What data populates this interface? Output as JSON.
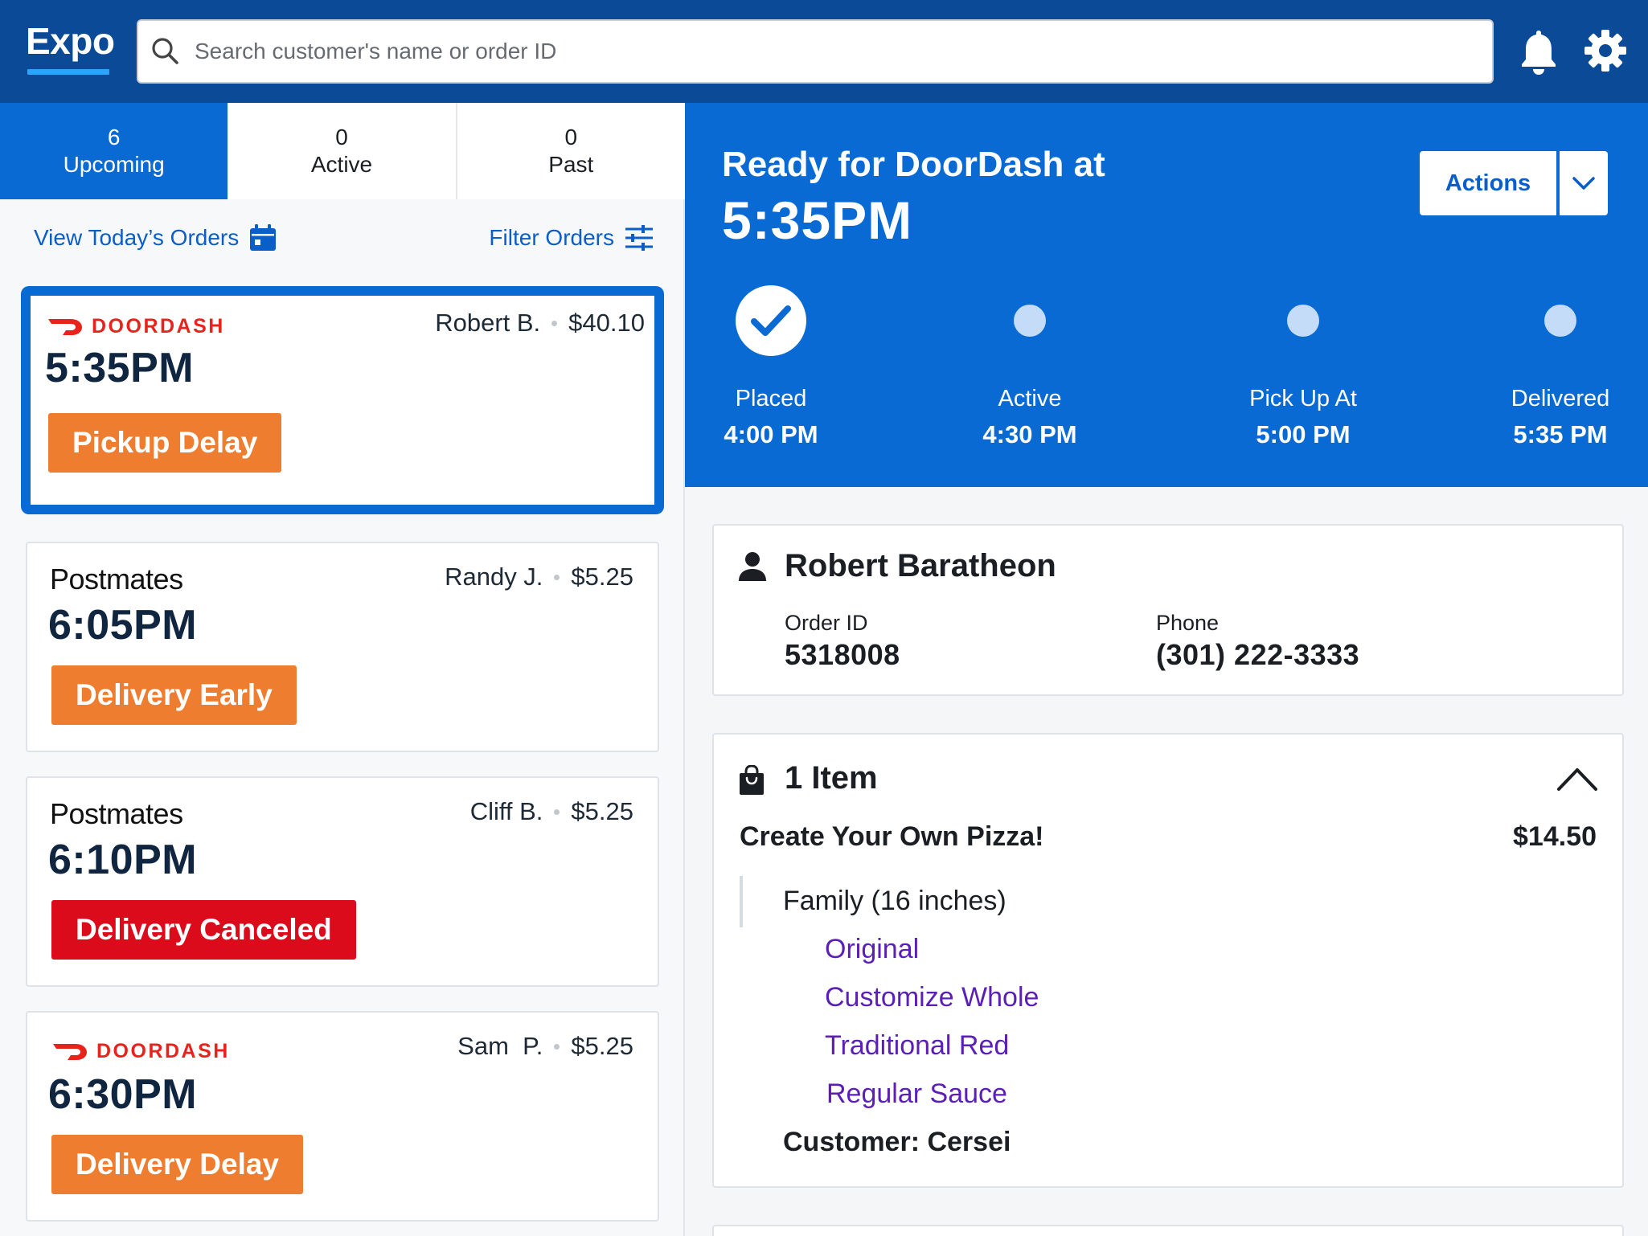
{
  "app": {
    "logo": "Expo"
  },
  "search": {
    "placeholder": "Search customer's name or order ID"
  },
  "tabs": [
    {
      "count": "6",
      "label": "Upcoming"
    },
    {
      "count": "0",
      "label": "Active"
    },
    {
      "count": "0",
      "label": "Past"
    }
  ],
  "links": {
    "today": "View Today’s Orders",
    "filter": "Filter Orders"
  },
  "orders": [
    {
      "brand": "DOORDASH",
      "customer": "Robert B.",
      "price": "$40.10",
      "time": "5:35PM",
      "status": "Pickup Delay",
      "status_color": "#ef7d2f"
    },
    {
      "brand": "Postmates",
      "customer": "Randy J.",
      "price": "$5.25",
      "time": "6:05PM",
      "status": "Delivery Early",
      "status_color": "#ef7d2f"
    },
    {
      "brand": "Postmates",
      "customer": "Cliff B.",
      "price": "$5.25",
      "time": "6:10PM",
      "status": "Delivery Canceled",
      "status_color": "#dc0b1b"
    },
    {
      "brand": "DOORDASH",
      "customer": "Sam  P.",
      "price": "$5.25",
      "time": "6:30PM",
      "status": "Delivery Delay",
      "status_color": "#ef7d2f"
    }
  ],
  "detail": {
    "title": "Ready for DoorDash at",
    "time": "5:35PM",
    "actions_label": "Actions",
    "steps": [
      {
        "label": "Placed",
        "time": "4:00 PM",
        "done": true
      },
      {
        "label": "Active",
        "time": "4:30 PM",
        "done": false
      },
      {
        "label": "Pick Up At",
        "time": "5:00 PM",
        "done": false
      },
      {
        "label": "Delivered",
        "time": "5:35 PM",
        "done": false
      }
    ],
    "customer": {
      "name": "Robert Baratheon",
      "order_id_label": "Order ID",
      "order_id": "5318008",
      "phone_label": "Phone",
      "phone": "(301) 222-3333"
    },
    "items": {
      "title": "1 Item",
      "name": "Create Your Own Pizza!",
      "price": "$14.50",
      "size": "Family (16 inches)",
      "modifiers": [
        "Original",
        "Customize Whole",
        "Traditional Red",
        "Regular Sauce"
      ],
      "customer_note": "Customer: Cersei"
    }
  },
  "colors": {
    "topbar": "#0a4a96",
    "primary": "#0a6ad4",
    "doordash": "#e8231c",
    "modifier": "#5b1fb8"
  }
}
